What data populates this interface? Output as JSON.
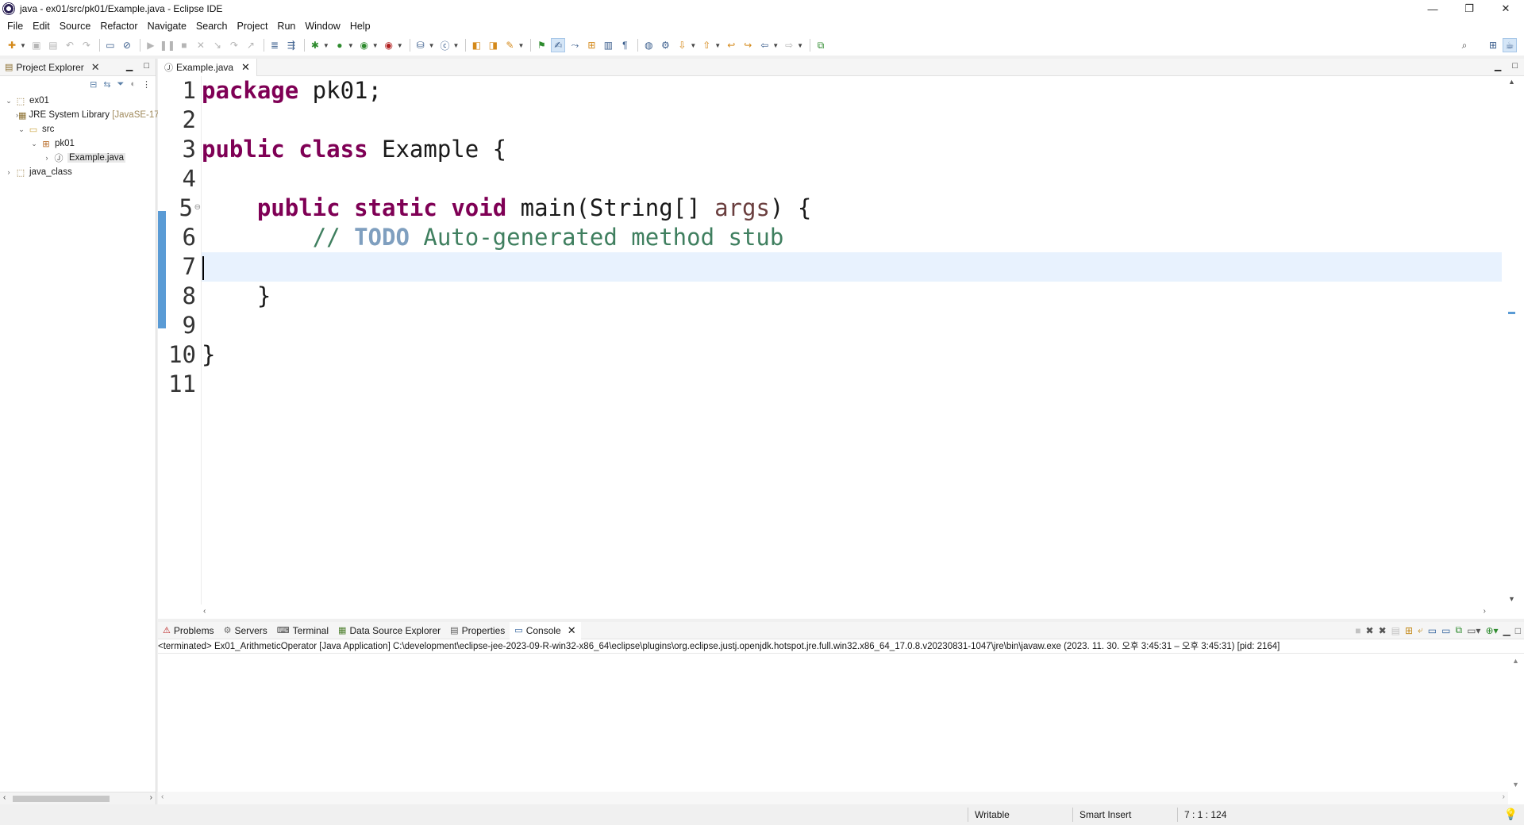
{
  "window": {
    "title": "java - ex01/src/pk01/Example.java - Eclipse IDE",
    "controls": {
      "minimize": "—",
      "restore": "❐",
      "close": "✕"
    }
  },
  "menu": [
    "File",
    "Edit",
    "Source",
    "Refactor",
    "Navigate",
    "Search",
    "Project",
    "Run",
    "Window",
    "Help"
  ],
  "explorer": {
    "title": "Project Explorer",
    "tree": [
      {
        "label": "ex01",
        "icon": "project-icon",
        "expanded": true
      },
      {
        "label": "JRE System Library",
        "decoration": "[JavaSE-17]",
        "icon": "library-icon"
      },
      {
        "label": "src",
        "icon": "source-folder-icon",
        "expanded": true
      },
      {
        "label": "pk01",
        "icon": "package-icon",
        "expanded": true
      },
      {
        "label": "Example.java",
        "icon": "java-file-icon",
        "selected": true
      },
      {
        "label": "java_class",
        "icon": "project-icon"
      }
    ]
  },
  "editor": {
    "tab_label": "Example.java",
    "line_numbers": [
      "1",
      "2",
      "3",
      "4",
      "5",
      "6",
      "7",
      "8",
      "9",
      "10",
      "11"
    ],
    "lines": {
      "l1_kw": "package",
      "l1_rest": " pk01;",
      "l3_kw1": "public",
      "l3_kw2": "class",
      "l3_rest": " Example {",
      "l5_kw1": "public",
      "l5_kw2": "static",
      "l5_kw3": "void",
      "l5_mid": " main(String[] ",
      "l5_param": "args",
      "l5_end": ") {",
      "l6_comment_start": "// ",
      "l6_todo": "TODO",
      "l6_comment_rest": " Auto-generated method stub",
      "l8": "}",
      "l10": "}"
    }
  },
  "console": {
    "tabs": [
      "Problems",
      "Servers",
      "Terminal",
      "Data Source Explorer",
      "Properties",
      "Console"
    ],
    "active_tab": "Console",
    "status": "<terminated> Ex01_ArithmeticOperator [Java Application] C:\\development\\eclipse-jee-2023-09-R-win32-x86_64\\eclipse\\plugins\\org.eclipse.justj.openjdk.hotspot.jre.full.win32.x86_64_17.0.8.v20230831-1047\\jre\\bin\\javaw.exe  (2023. 11. 30. 오후 3:45:31 – 오후 3:45:31) [pid: 2164]"
  },
  "statusbar": {
    "mode": "Writable",
    "insert": "Smart Insert",
    "position": "7 : 1 : 124"
  },
  "colors": {
    "keyword": "#7f0055",
    "comment": "#3f7f5f",
    "todo": "#7f9fbf",
    "current_line": "#e8f2fe",
    "change_ruler": "#5a9bd5"
  }
}
